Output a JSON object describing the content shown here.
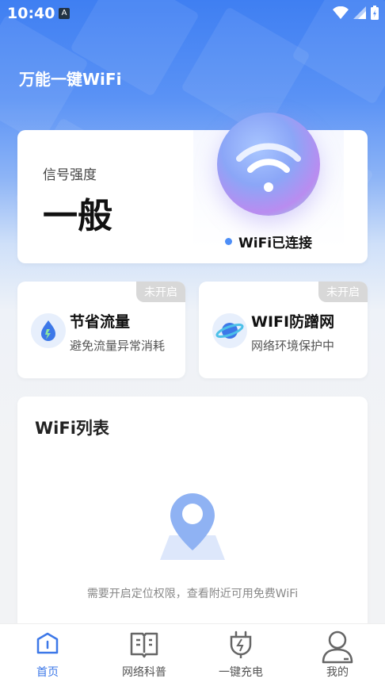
{
  "status_bar": {
    "time": "10:40",
    "app_badge": "A"
  },
  "app": {
    "title": "万能一键WiFi"
  },
  "signal": {
    "label": "信号强度",
    "value": "一般",
    "connection_status": "WiFi已连接"
  },
  "features": [
    {
      "badge": "未开启",
      "title": "节省流量",
      "subtitle": "避免流量异常消耗",
      "icon": "water-drop-icon"
    },
    {
      "badge": "未开启",
      "title": "WIFI防蹭网",
      "subtitle": "网络环境保护中",
      "icon": "planet-icon"
    }
  ],
  "wifi_list": {
    "title": "WiFi列表",
    "hint": "需要开启定位权限，查看附近可用免费WiFi"
  },
  "tabs": [
    {
      "label": "首页",
      "icon": "home-icon",
      "active": true
    },
    {
      "label": "网络科普",
      "icon": "book-icon",
      "active": false
    },
    {
      "label": "一键充电",
      "icon": "charge-plug-icon",
      "active": false
    },
    {
      "label": "我的",
      "icon": "user-icon",
      "active": false
    }
  ],
  "colors": {
    "accent": "#3d78e8",
    "badge": "#d8d8d8"
  }
}
